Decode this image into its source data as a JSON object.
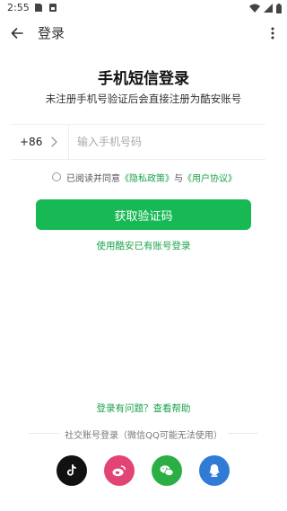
{
  "status_bar": {
    "time": "2:55",
    "icons": [
      "notification-icon",
      "sim-icon",
      "wifi-icon",
      "signal-icon",
      "battery-icon"
    ]
  },
  "app_bar": {
    "title": "登录",
    "back_icon": "arrow-left-icon",
    "menu_icon": "more-vertical-icon"
  },
  "login": {
    "title": "手机短信登录",
    "subtitle": "未注册手机号验证后会直接注册为酷安账号",
    "country_code": "+86",
    "phone_placeholder": "输入手机号码",
    "phone_value": "",
    "agreement": {
      "prefix": "已阅读并同意",
      "privacy": "《隐私政策》",
      "and": "与",
      "terms": "《用户协议》",
      "checked": false
    },
    "submit_label": "获取验证码",
    "alt_login": "使用酷安已有账号登录"
  },
  "footer": {
    "help": "登录有问题？查看帮助",
    "social_label": "社交账号登录（微信QQ可能无法使用）",
    "social": [
      {
        "name": "tiktok",
        "icon": "tiktok-icon",
        "color": "#111111"
      },
      {
        "name": "weibo",
        "icon": "weibo-icon",
        "color": "#e24575"
      },
      {
        "name": "wechat",
        "icon": "wechat-icon",
        "color": "#2bae43"
      },
      {
        "name": "qq",
        "icon": "qq-icon",
        "color": "#2f7bd6"
      }
    ]
  },
  "colors": {
    "accent": "#17b955",
    "link": "#1aa34a"
  }
}
